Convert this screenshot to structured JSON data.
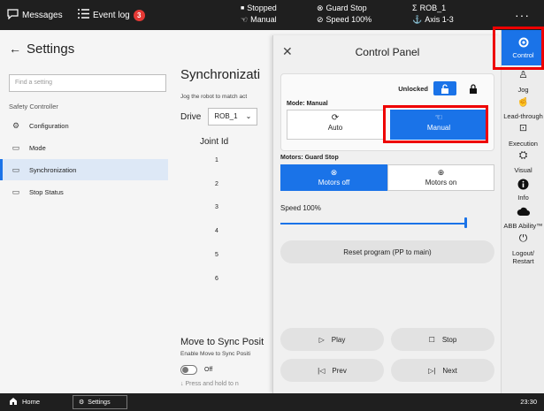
{
  "topbar": {
    "messages_label": "Messages",
    "eventlog_label": "Event log",
    "eventlog_count": "3",
    "status": {
      "state": "Stopped",
      "mode": "Manual",
      "safety": "Guard Stop",
      "speed": "Speed 100%",
      "robot": "ROB_1",
      "axes": "Axis 1-3"
    },
    "more_label": "···"
  },
  "sidebar_right": {
    "items": [
      {
        "label": "Control",
        "icon": "gear-icon",
        "active": true
      },
      {
        "label": "Jog",
        "icon": "jog-icon"
      },
      {
        "label": "Lead-through",
        "icon": "lead-through-icon"
      },
      {
        "label": "Execution",
        "icon": "execution-icon"
      },
      {
        "label": "Visual",
        "icon": "visual-icon"
      },
      {
        "label": "Info",
        "icon": "info-icon"
      },
      {
        "label": "ABB Ability™",
        "icon": "cloud-icon"
      },
      {
        "label": "Logout/",
        "label2": "Restart",
        "icon": "logout-icon"
      }
    ]
  },
  "settings": {
    "title": "Settings",
    "search_placeholder": "Find a setting",
    "section": "Safety Controller",
    "nav": [
      {
        "label": "Configuration",
        "icon": "gear-icon"
      },
      {
        "label": "Mode",
        "icon": "mode-icon"
      },
      {
        "label": "Synchronization",
        "icon": "sync-icon",
        "selected": true
      },
      {
        "label": "Stop Status",
        "icon": "stop-status-icon"
      }
    ],
    "sync": {
      "title": "Synchronizati",
      "subtitle": "Jog the robot to match act",
      "drive_label": "Drive",
      "drive_value": "ROB_1",
      "joint_header": "Joint Id",
      "joints": [
        "1",
        "2",
        "3",
        "4",
        "5",
        "6"
      ],
      "move_title": "Move to Sync Posit",
      "move_subtitle": "Enable Move to Sync Positi",
      "toggle_label": "Off",
      "press_hold": "↓  Press and hold to n"
    }
  },
  "control_panel": {
    "title": "Control Panel",
    "unlocked_label": "Unlocked",
    "mode_label": "Mode: Manual",
    "mode_auto": "Auto",
    "mode_manual": "Manual",
    "motors_label": "Motors: Guard Stop",
    "motors_off": "Motors off",
    "motors_on": "Motors on",
    "speed_label": "Speed 100%",
    "speed_value": 100,
    "reset_label": "Reset program (PP to main)",
    "play_label": "Play",
    "stop_label": "Stop",
    "prev_label": "Prev",
    "next_label": "Next"
  },
  "taskbar": {
    "home_label": "Home",
    "settings_label": "Settings",
    "time": "23:30"
  },
  "colors": {
    "accent": "#1a73e8",
    "topbar": "#1f1f1f",
    "highlight": "#e00000"
  }
}
